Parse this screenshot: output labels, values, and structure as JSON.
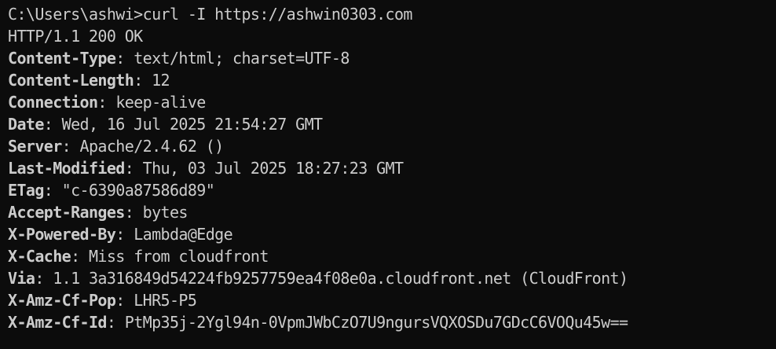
{
  "terminal": {
    "prompt": "C:\\Users\\ashwi>",
    "command": "curl -I https://ashwin0303.com",
    "status_line": "HTTP/1.1 200 OK",
    "headers": [
      {
        "name": "Content-Type",
        "value": "text/html; charset=UTF-8"
      },
      {
        "name": "Content-Length",
        "value": "12"
      },
      {
        "name": "Connection",
        "value": "keep-alive"
      },
      {
        "name": "Date",
        "value": "Wed, 16 Jul 2025 21:54:27 GMT"
      },
      {
        "name": "Server",
        "value": "Apache/2.4.62 ()"
      },
      {
        "name": "Last-Modified",
        "value": "Thu, 03 Jul 2025 18:27:23 GMT"
      },
      {
        "name": "ETag",
        "value": "\"c-6390a87586d89\""
      },
      {
        "name": "Accept-Ranges",
        "value": "bytes"
      },
      {
        "name": "X-Powered-By",
        "value": "Lambda@Edge"
      },
      {
        "name": "X-Cache",
        "value": "Miss from cloudfront"
      },
      {
        "name": "Via",
        "value": "1.1 3a316849d54224fb9257759ea4f08e0a.cloudfront.net (CloudFront)"
      },
      {
        "name": "X-Amz-Cf-Pop",
        "value": "LHR5-P5"
      },
      {
        "name": "X-Amz-Cf-Id",
        "value": "PtMp35j-2Ygl94n-0VpmJWbCzO7U9ngursVQXOSDu7GDcC6VOQu45w=="
      }
    ],
    "colors": {
      "background": "#0c0c0c",
      "foreground": "#cccccc"
    }
  }
}
